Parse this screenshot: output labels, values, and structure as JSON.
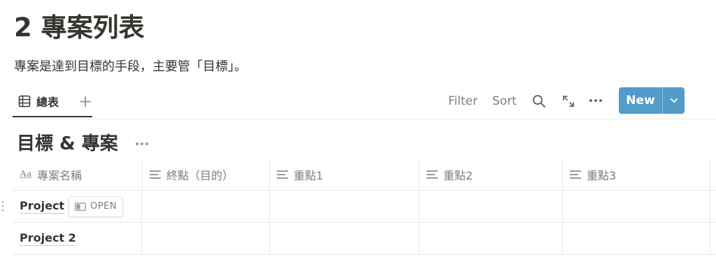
{
  "page": {
    "title": "2 專案列表",
    "description": "專案是達到目標的手段，主要管「目標」。"
  },
  "view_bar": {
    "tabs": [
      {
        "label": "總表",
        "icon": "table-icon",
        "active": true
      }
    ],
    "add_view_label": "+",
    "filter_label": "Filter",
    "sort_label": "Sort",
    "new_label": "New",
    "accent_color": "#529cca"
  },
  "database": {
    "title": "目標 & 專案",
    "columns": [
      {
        "label": "專案名稱",
        "icon": "text-type-icon"
      },
      {
        "label": "終點（目的）",
        "icon": "text-property-icon"
      },
      {
        "label": "重點1",
        "icon": "text-property-icon"
      },
      {
        "label": "重點2",
        "icon": "text-property-icon"
      },
      {
        "label": "重點3",
        "icon": "text-property-icon"
      }
    ],
    "rows": [
      {
        "name": "Project",
        "open_label": "OPEN"
      },
      {
        "name": "Project 2"
      }
    ]
  }
}
